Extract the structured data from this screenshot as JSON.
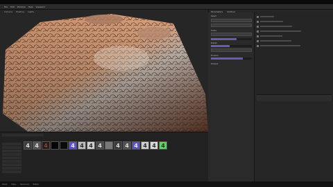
{
  "menu": [
    "File",
    "Edit",
    "Window",
    "Help",
    "Viewport"
  ],
  "viewport": {
    "toolbar": [
      "Camera",
      "Shading",
      "Lights"
    ]
  },
  "panel": {
    "tabs": [
      "Parameters",
      "Outliner"
    ],
    "sections": [
      "Seed",
      "Scale",
      "Detail",
      "Erosion",
      "Output"
    ],
    "sliders": [
      0.62,
      0.45,
      0.78
    ]
  },
  "outliner": {
    "rows": 7
  },
  "thumbnails": [
    {
      "label": "4",
      "color": "#dcdcdc",
      "bg": "#3c3c3c"
    },
    {
      "label": "4",
      "color": "#dcdcdc",
      "bg": "#555555"
    },
    {
      "label": "4",
      "color": "#7a4a3a",
      "bg": "#2a1a14"
    },
    {
      "label": "",
      "color": "#000000",
      "bg": "#050505"
    },
    {
      "label": "",
      "color": "#000000",
      "bg": "#0b0b0b"
    },
    {
      "label": "4",
      "color": "#eaeaea",
      "bg": "#5a52c4"
    },
    {
      "label": "4",
      "color": "#2a2a2a",
      "bg": "#bdbdbd"
    },
    {
      "label": "4",
      "color": "#2a2a2a",
      "bg": "#cfcfcf"
    },
    {
      "label": "4",
      "color": "#dcdcdc",
      "bg": "#4a4a4a"
    },
    {
      "label": "",
      "color": "#ffffff",
      "bg": "#777777"
    },
    {
      "label": "4",
      "color": "#dcdcdc",
      "bg": "#3a3a3a"
    },
    {
      "label": "4",
      "color": "#dcdcdc",
      "bg": "#505050"
    },
    {
      "label": "4",
      "color": "#eaeaea",
      "bg": "#5a52c4"
    },
    {
      "label": "4",
      "color": "#2a2a2a",
      "bg": "#cfcfcf"
    },
    {
      "label": "4",
      "color": "#2a2a2a",
      "bg": "#d9d9d9"
    },
    {
      "label": "4",
      "color": "#2a2a2a",
      "bg": "#5fd35f"
    }
  ],
  "taskbar": [
    "Start",
    "Files",
    "Terminal",
    "Editor"
  ],
  "colors": {
    "accent": "#6a5bb0",
    "terrain_light": "#d9a27d",
    "terrain_dark": "#6a3b2b"
  }
}
